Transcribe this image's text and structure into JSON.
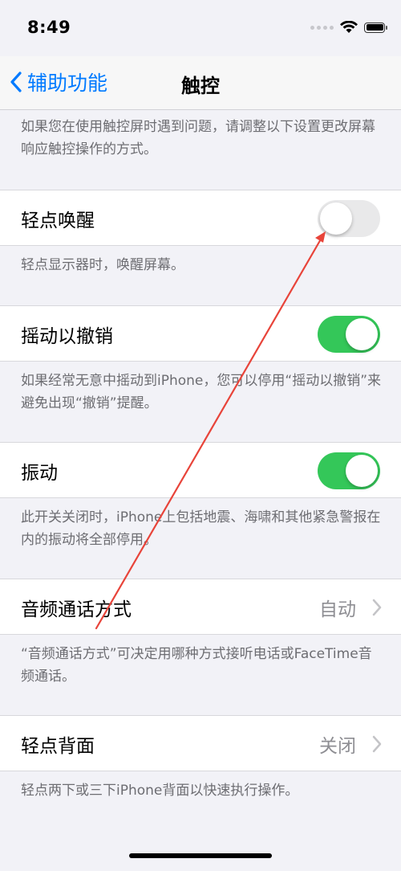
{
  "status_bar": {
    "time": "8:49"
  },
  "nav": {
    "back_label": "辅助功能",
    "title": "触控"
  },
  "intro": "如果您在使用触控屏时遇到问题，请调整以下设置更改屏幕响应触控操作的方式。",
  "settings": [
    {
      "label": "轻点唤醒",
      "type": "toggle",
      "on": false,
      "footer": "轻点显示器时，唤醒屏幕。"
    },
    {
      "label": "摇动以撤销",
      "type": "toggle",
      "on": true,
      "footer": "如果经常无意中摇动到iPhone，您可以停用“摇动以撤销”来避免出现“撤销”提醒。"
    },
    {
      "label": "振动",
      "type": "toggle",
      "on": true,
      "footer": "此开关关闭时，iPhone上包括地震、海啸和其他紧急警报在内的振动将全部停用。"
    },
    {
      "label": "音频通话方式",
      "type": "disclosure",
      "value": "自动",
      "footer": "“音频通话方式”可决定用哪种方式接听电话或FaceTime音频通话。"
    },
    {
      "label": "轻点背面",
      "type": "disclosure",
      "value": "关闭",
      "footer": "轻点两下或三下iPhone背面以快速执行操作。"
    }
  ],
  "colors": {
    "accent": "#007aff",
    "toggle_on": "#34c759",
    "toggle_off": "#e9e9ea",
    "annotation": "#e8443a"
  }
}
